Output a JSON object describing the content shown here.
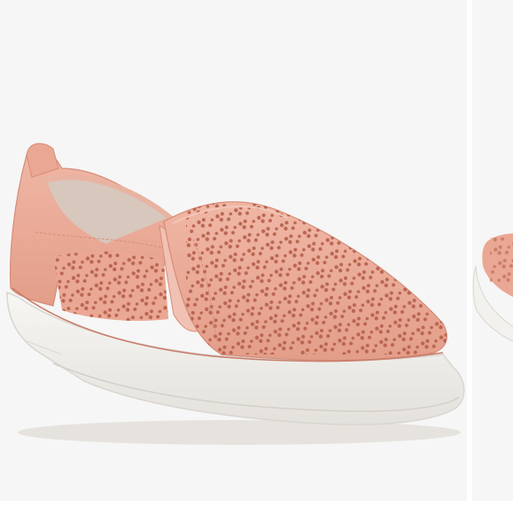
{
  "gallery": {
    "current_image": {
      "subject": "shoe-photo",
      "colors": {
        "upper": "#eaa894",
        "upper_shadow": "#d88f7c",
        "upper_highlight": "#f0b7a5",
        "perforation": "#b8624e",
        "lining": "#d8c7bd",
        "sole": "#f3f1ee",
        "sole_shadow": "#dedbd6",
        "background": "#f6f6f6"
      }
    },
    "next_image": {
      "subject": "shoe-photo-partial"
    }
  }
}
